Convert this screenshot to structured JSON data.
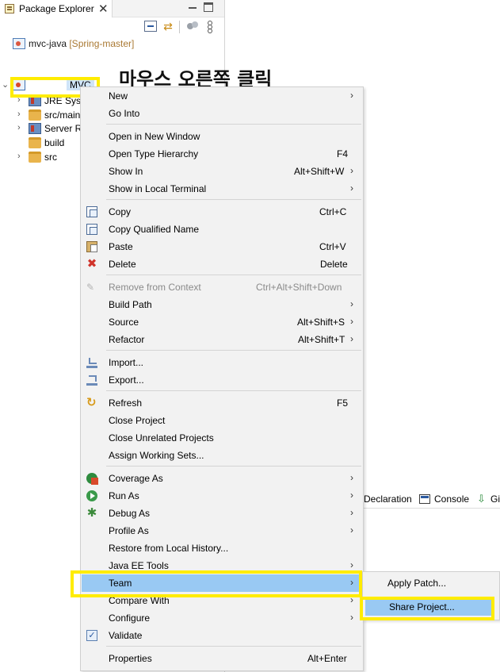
{
  "explorer": {
    "tab_title": "Package Explorer",
    "close_glyph": "✕",
    "tree": {
      "mvc_java": {
        "label": "mvc-java",
        "decoration": " [Spring-master]"
      },
      "mvc": {
        "label": "MVC"
      },
      "jre": {
        "label": "JRE Syste"
      },
      "src_main": {
        "label": "src/main"
      },
      "server": {
        "label": "Server R"
      },
      "build": {
        "label": "build"
      },
      "src": {
        "label": "src"
      }
    }
  },
  "annotation": {
    "title": "마우스 오른쪽 클릭",
    "highlight_color": "#ffec00"
  },
  "context_menu": {
    "items": [
      {
        "label": "New",
        "accel": "",
        "submenu": true
      },
      {
        "label": "Go Into",
        "accel": "",
        "submenu": false
      },
      {
        "label": "Open in New Window",
        "accel": "",
        "submenu": false
      },
      {
        "label": "Open Type Hierarchy",
        "accel": "F4",
        "submenu": false
      },
      {
        "label": "Show In",
        "accel": "Alt+Shift+W",
        "submenu": true
      },
      {
        "label": "Show in Local Terminal",
        "accel": "",
        "submenu": true
      },
      {
        "label": "Copy",
        "accel": "Ctrl+C",
        "submenu": false,
        "icon": "copy-icon"
      },
      {
        "label": "Copy Qualified Name",
        "accel": "",
        "submenu": false,
        "icon": "copy-qualified-icon"
      },
      {
        "label": "Paste",
        "accel": "Ctrl+V",
        "submenu": false,
        "icon": "paste-icon"
      },
      {
        "label": "Delete",
        "accel": "Delete",
        "submenu": false,
        "icon": "delete-icon"
      },
      {
        "label": "Remove from Context",
        "accel": "Ctrl+Alt+Shift+Down",
        "submenu": false,
        "disabled": true,
        "icon": "remove-context-icon"
      },
      {
        "label": "Build Path",
        "accel": "",
        "submenu": true
      },
      {
        "label": "Source",
        "accel": "Alt+Shift+S",
        "submenu": true
      },
      {
        "label": "Refactor",
        "accel": "Alt+Shift+T",
        "submenu": true
      },
      {
        "label": "Import...",
        "accel": "",
        "submenu": false,
        "icon": "import-icon"
      },
      {
        "label": "Export...",
        "accel": "",
        "submenu": false,
        "icon": "export-icon"
      },
      {
        "label": "Refresh",
        "accel": "F5",
        "submenu": false,
        "icon": "refresh-icon"
      },
      {
        "label": "Close Project",
        "accel": "",
        "submenu": false
      },
      {
        "label": "Close Unrelated Projects",
        "accel": "",
        "submenu": false
      },
      {
        "label": "Assign Working Sets...",
        "accel": "",
        "submenu": false
      },
      {
        "label": "Coverage As",
        "accel": "",
        "submenu": true,
        "icon": "coverage-icon"
      },
      {
        "label": "Run As",
        "accel": "",
        "submenu": true,
        "icon": "run-icon"
      },
      {
        "label": "Debug As",
        "accel": "",
        "submenu": true,
        "icon": "debug-icon"
      },
      {
        "label": "Profile As",
        "accel": "",
        "submenu": true
      },
      {
        "label": "Restore from Local History...",
        "accel": "",
        "submenu": false
      },
      {
        "label": "Java EE Tools",
        "accel": "",
        "submenu": true
      },
      {
        "label": "Team",
        "accel": "",
        "submenu": true,
        "selected": true
      },
      {
        "label": "Compare With",
        "accel": "",
        "submenu": true
      },
      {
        "label": "Configure",
        "accel": "",
        "submenu": true
      },
      {
        "label": "Validate",
        "accel": "",
        "submenu": false,
        "icon": "validate-checkbox-icon"
      },
      {
        "label": "Properties",
        "accel": "Alt+Enter",
        "submenu": false
      }
    ],
    "submenu_glyph": "›"
  },
  "team_submenu": {
    "items": [
      {
        "label": "Apply Patch..."
      },
      {
        "label": "Share Project...",
        "selected": true
      }
    ]
  },
  "bottom_panel": {
    "tabs": {
      "declaration": "Declaration",
      "console": "Console",
      "git": "Gi"
    }
  },
  "colors": {
    "menu_bg": "#f2f2f2",
    "selection": "#99c9f3",
    "highlight": "#ffec00"
  }
}
